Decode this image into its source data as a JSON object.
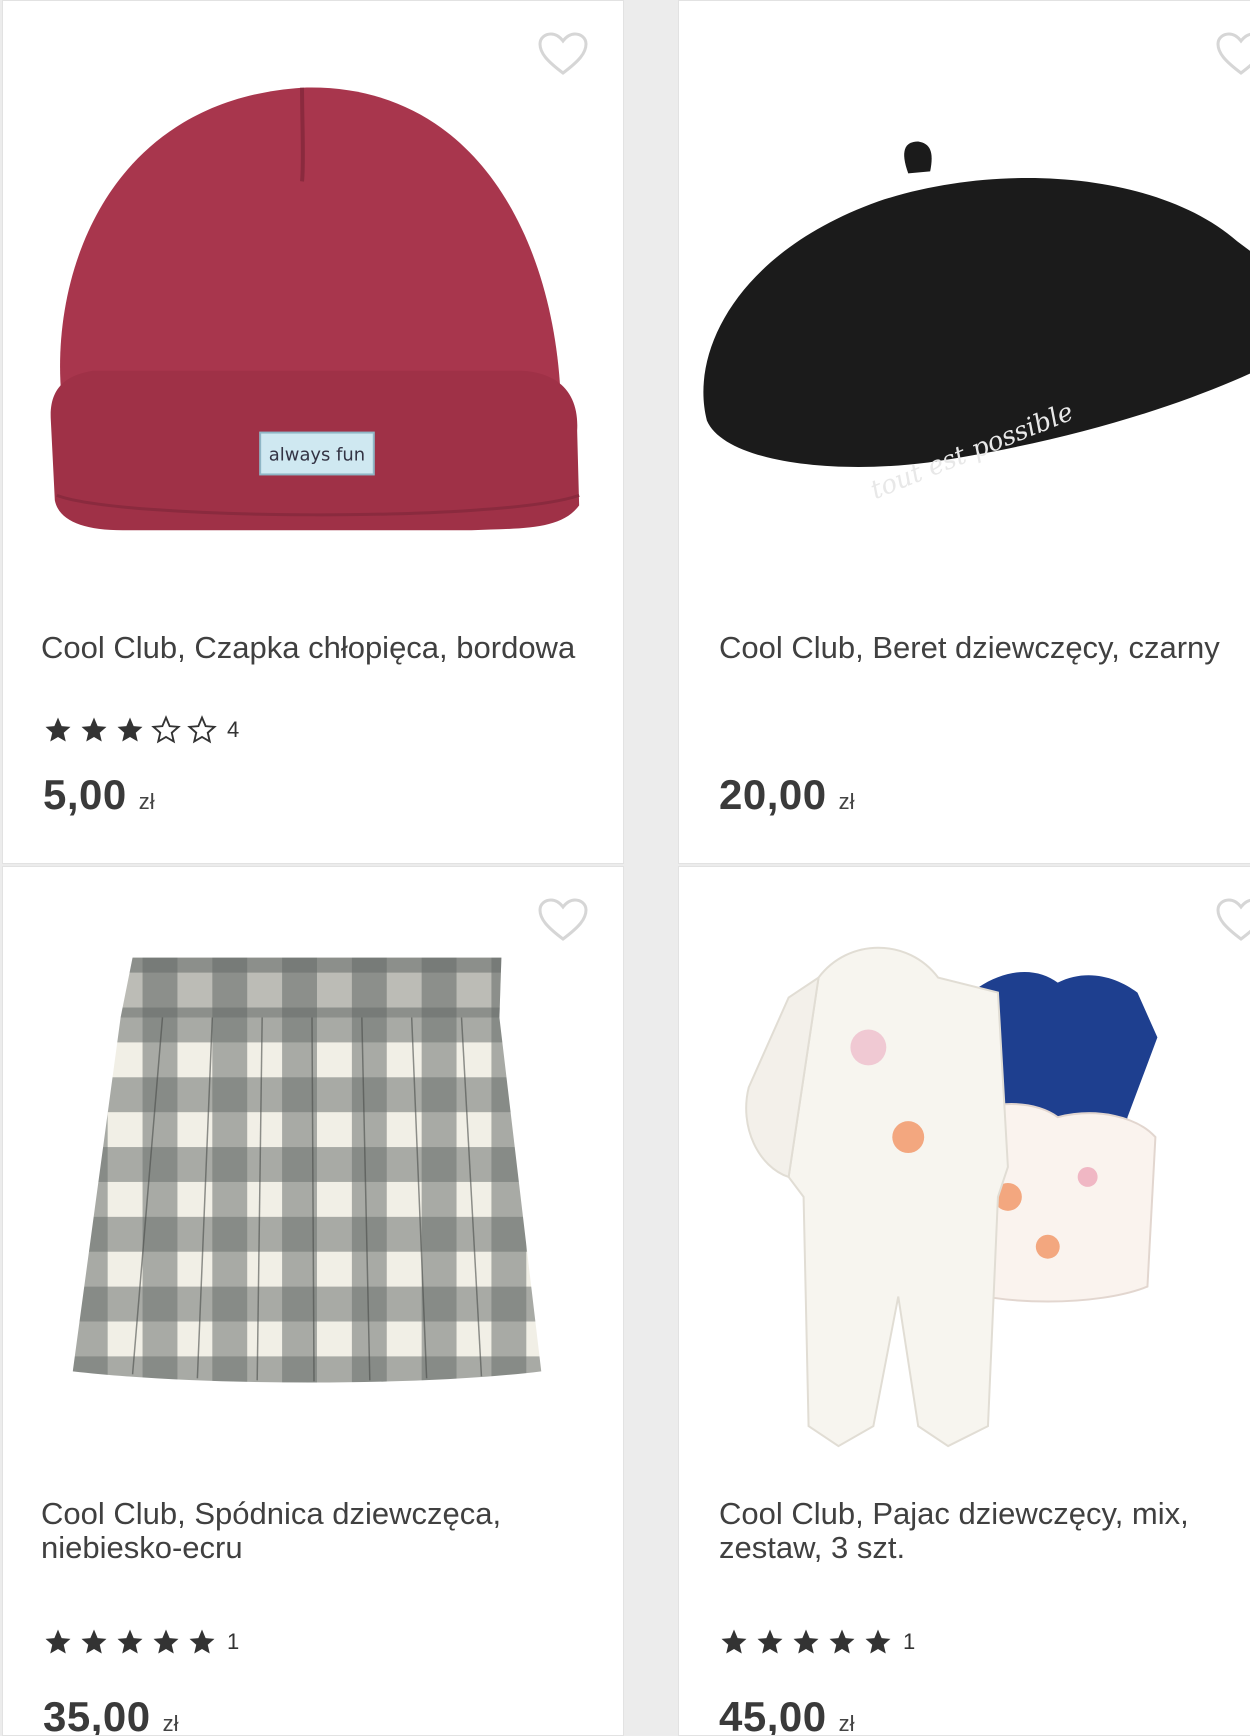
{
  "products": [
    {
      "title": "Cool Club, Czapka chłopięca, bordowa",
      "rating_stars": 3,
      "rating_count": "4",
      "price": "5,00",
      "currency": "zł",
      "image": "burgundy-beanie-image",
      "label_text": "always fun"
    },
    {
      "title": "Cool Club, Beret dziewczęcy, czarny",
      "rating_stars": null,
      "rating_count": "",
      "price": "20,00",
      "currency": "zł",
      "image": "black-beret-image",
      "embroidery_text": "tout est possible"
    },
    {
      "title": "Cool Club, Spódnica dziewczęca, niebiesko-ecru",
      "rating_stars": 5,
      "rating_count": "1",
      "price": "35,00",
      "currency": "zł",
      "image": "plaid-skirt-image"
    },
    {
      "title": "Cool Club, Pajac dziewczęcy, mix, zestaw, 3 szt.",
      "rating_stars": 5,
      "rating_count": "1",
      "price": "45,00",
      "currency": "zł",
      "image": "romper-set-image"
    }
  ],
  "icons": {
    "favorite": "heart-outline-icon",
    "star_full": "star-filled-icon",
    "star_empty": "star-outline-icon"
  },
  "colors": {
    "text": "#404040",
    "star": "#333333",
    "heart": "#d6d6d6",
    "beanie": "#a8364d",
    "beret": "#1b1b1b"
  }
}
